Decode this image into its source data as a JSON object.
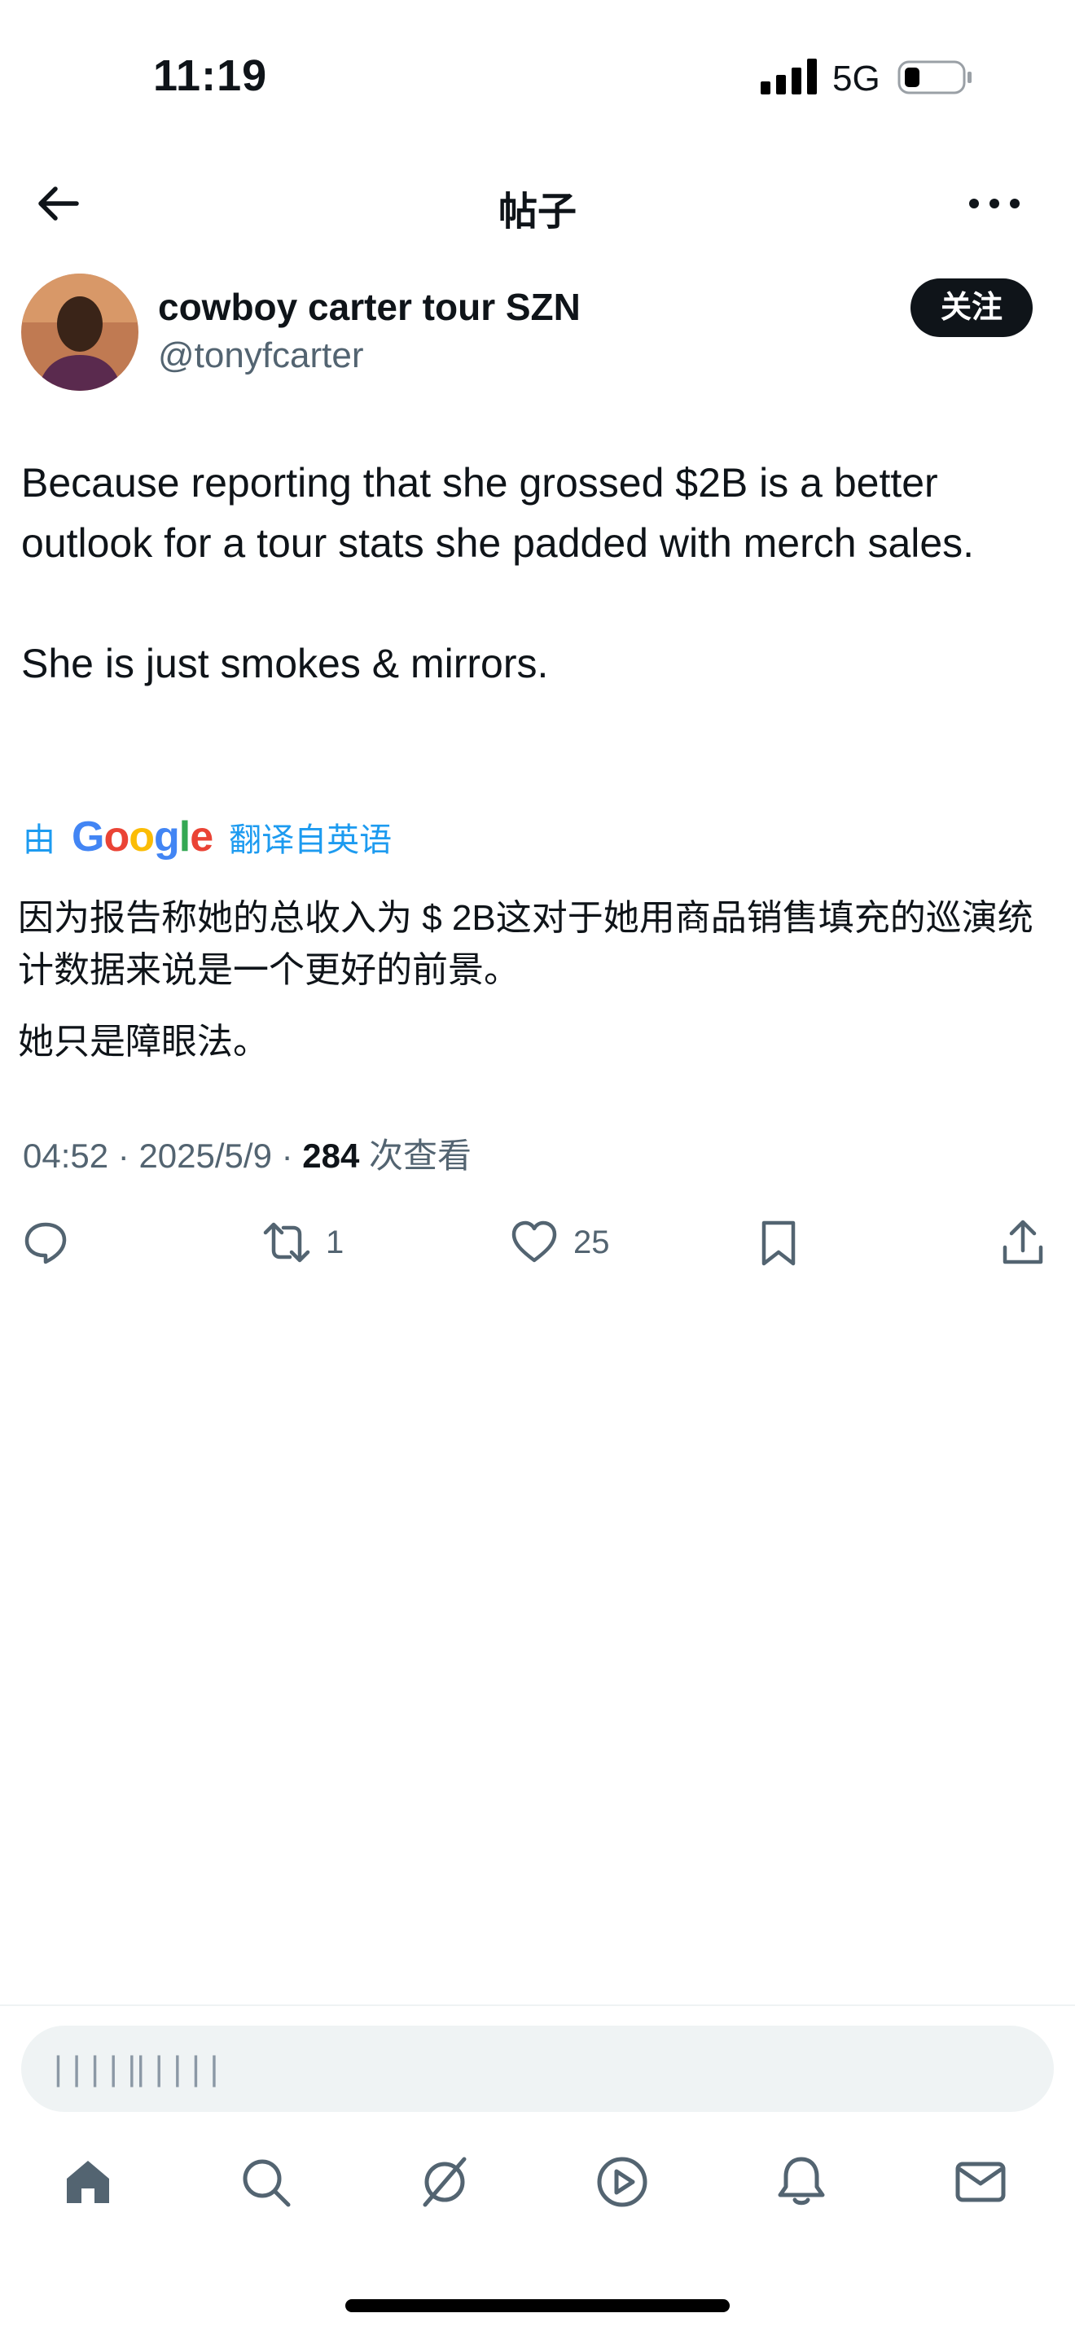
{
  "status_bar": {
    "time": "11:19",
    "network": "5G"
  },
  "header": {
    "title": "帖子",
    "back_icon": "arrow-left-icon",
    "more_icon": "more-horizontal-icon"
  },
  "author": {
    "display_name": "cowboy carter tour SZN",
    "handle": "@tonyfcarter",
    "follow_label": "关注"
  },
  "tweet": {
    "text": "Because reporting that she grossed $2B is a better outlook for a tour stats she padded with merch sales.\n\nShe is just smokes & mirrors.",
    "translation_by": "由",
    "translation_logo": "Google",
    "translation_from": "翻译自英语",
    "translated_p1": "因为报告称她的总收入为 $ 2B这对于她用商品销售填充的巡演统计数据来说是一个更好的前景。",
    "translated_p2": "她只是障眼法。",
    "time": "04:52",
    "date": "2025/5/9",
    "views": "284",
    "views_label": "次查看",
    "separator": "·"
  },
  "actions": {
    "retweets": "1",
    "likes": "25"
  },
  "reply": {
    "placeholder": "| | | | || | | | |"
  },
  "colors": {
    "accent": "#1d9bf0",
    "text": "#0f1419",
    "muted": "#536471"
  }
}
